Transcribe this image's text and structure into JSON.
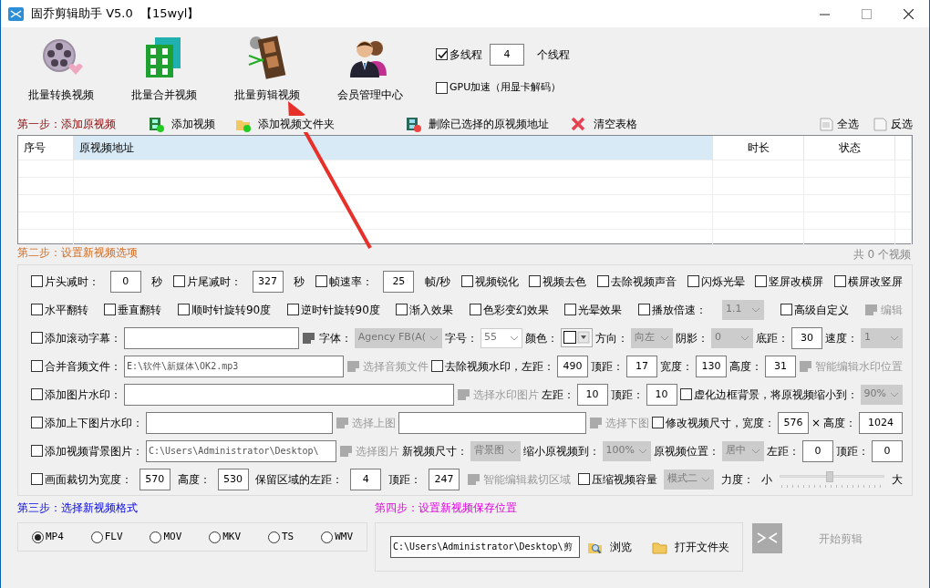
{
  "window": {
    "title": "固乔剪辑助手 V5.0  【15wyl】"
  },
  "toolbar": [
    {
      "kind": "convert",
      "label": "批量转换视频"
    },
    {
      "kind": "merge",
      "label": "批量合并视频"
    },
    {
      "kind": "edit",
      "label": "批量剪辑视频"
    },
    {
      "kind": "members",
      "label": "会员管理中心"
    }
  ],
  "threads": {
    "multithread": {
      "label": "多线程",
      "checked": true
    },
    "count": "4",
    "unit": "个线程",
    "gpu": {
      "label": "GPU加速（用显卡解码）",
      "checked": false
    }
  },
  "step1": {
    "title": "第一步：添加原视频",
    "actions": [
      {
        "kind": "add",
        "label": "添加视频"
      },
      {
        "kind": "folder",
        "label": "添加视频文件夹"
      },
      {
        "kind": "delete",
        "label": "删除已选择的原视频地址"
      },
      {
        "kind": "clear",
        "label": "清空表格"
      }
    ],
    "select_all": "全选",
    "invert": "反选"
  },
  "table": {
    "columns": [
      {
        "label": "序号",
        "selected": false
      },
      {
        "label": "原视频地址",
        "selected": true
      },
      {
        "label": "时长",
        "selected": false
      },
      {
        "label": "状态",
        "selected": false
      }
    ],
    "count": "共 0 个视频"
  },
  "step2": {
    "title": "第二步：设置新视频选项",
    "rows": [
      {
        "items": [
          {
            "kind": "check",
            "label": "片头减时：",
            "checked": false
          },
          {
            "kind": "number",
            "value": "0"
          },
          {
            "kind": "text",
            "label": "秒"
          },
          {
            "kind": "check",
            "label": "片尾减时：",
            "checked": false
          },
          {
            "kind": "number",
            "value": "327"
          },
          {
            "kind": "text",
            "label": "秒"
          },
          {
            "kind": "check",
            "label": "帧速率：",
            "checked": false
          },
          {
            "kind": "number",
            "value": "25"
          },
          {
            "kind": "text",
            "label": "帧/秒"
          },
          {
            "kind": "check",
            "label": "视频锐化",
            "checked": false
          },
          {
            "kind": "check",
            "label": "视频去色",
            "checked": false
          },
          {
            "kind": "check",
            "label": "去除视频声音",
            "checked": false
          },
          {
            "kind": "check",
            "label": "闪烁光晕",
            "checked": false
          },
          {
            "kind": "check",
            "label": "竖屏改横屏",
            "checked": false
          },
          {
            "kind": "check",
            "label": "横屏改竖屏",
            "checked": false
          }
        ]
      },
      {
        "items": [
          {
            "kind": "check",
            "label": "水平翻转",
            "checked": false
          },
          {
            "kind": "check",
            "label": "垂直翻转",
            "checked": false
          },
          {
            "kind": "check",
            "label": "顺时针旋转90度",
            "checked": false
          },
          {
            "kind": "check",
            "label": "逆时针旋转90度",
            "checked": false
          },
          {
            "kind": "check",
            "label": "渐入效果",
            "checked": false
          },
          {
            "kind": "check",
            "label": "色彩变幻效果",
            "checked": false
          },
          {
            "kind": "check",
            "label": "光晕效果",
            "checked": false
          },
          {
            "kind": "check",
            "label": "播放倍速：",
            "checked": false
          },
          {
            "kind": "select",
            "value": "1.1",
            "disabled": true
          },
          {
            "kind": "check",
            "label": "高级自定义",
            "checked": false
          },
          {
            "kind": "tool",
            "label": "编辑",
            "disabled": true
          }
        ]
      },
      {
        "items": [
          {
            "kind": "check",
            "label": "添加滚动字幕：",
            "checked": false
          },
          {
            "kind": "path"
          },
          {
            "kind": "tool",
            "disabled": false
          },
          {
            "kind": "text",
            "label": "字体："
          },
          {
            "kind": "select",
            "value": "Agency FB(A(",
            "disabled": true
          },
          {
            "kind": "text",
            "label": "字号："
          },
          {
            "kind": "select",
            "value": "55",
            "disabled": false
          },
          {
            "kind": "text",
            "label": "颜色："
          },
          {
            "kind": "color"
          },
          {
            "kind": "text",
            "label": "方向："
          },
          {
            "kind": "select",
            "value": "向左",
            "disabled": true
          },
          {
            "kind": "text",
            "label": "阴影："
          },
          {
            "kind": "select",
            "value": "0",
            "disabled": true
          },
          {
            "kind": "text",
            "label": "底距："
          },
          {
            "kind": "number",
            "value": "30"
          },
          {
            "kind": "text",
            "label": "速度："
          },
          {
            "kind": "select",
            "value": "1",
            "disabled": true
          }
        ]
      },
      {
        "items": [
          {
            "kind": "check",
            "label": "合并音频文件：",
            "checked": false
          },
          {
            "kind": "path",
            "value": "E:\\软件\\新媒体\\OK2.mp3",
            "disabled": true
          },
          {
            "kind": "tool",
            "label": "选择音频文件",
            "disabled": true
          },
          {
            "kind": "check",
            "label": "去除视频水印，左距：",
            "checked": false
          },
          {
            "kind": "number",
            "value": "490"
          },
          {
            "kind": "text",
            "label": "顶距："
          },
          {
            "kind": "number",
            "value": "17"
          },
          {
            "kind": "text",
            "label": "宽度："
          },
          {
            "kind": "number",
            "value": "130"
          },
          {
            "kind": "text",
            "label": "高度："
          },
          {
            "kind": "number",
            "value": "31"
          },
          {
            "kind": "tool",
            "label": "智能编辑水印位置",
            "disabled": true
          }
        ]
      },
      {
        "items": [
          {
            "kind": "check",
            "label": "添加图片水印：",
            "checked": false
          },
          {
            "kind": "path"
          },
          {
            "kind": "tool",
            "label": "选择水印图片",
            "disabled": true
          },
          {
            "kind": "text",
            "label": "左距："
          },
          {
            "kind": "number",
            "value": "10"
          },
          {
            "kind": "text",
            "label": "顶距："
          },
          {
            "kind": "number",
            "value": "10"
          },
          {
            "kind": "check",
            "label": "虚化边框背景，将原视频缩小到：",
            "checked": false
          },
          {
            "kind": "select",
            "value": "90%",
            "disabled": true
          }
        ]
      },
      {
        "items": [
          {
            "kind": "check",
            "label": "添加上下图片水印：",
            "checked": false
          },
          {
            "kind": "path"
          },
          {
            "kind": "tool",
            "label": "选择上图",
            "disabled": true
          },
          {
            "kind": "path"
          },
          {
            "kind": "tool",
            "label": "选择下图",
            "disabled": true
          },
          {
            "kind": "check",
            "label": "修改视频尺寸，宽度：",
            "checked": false
          },
          {
            "kind": "number",
            "value": "576"
          },
          {
            "kind": "text",
            "label": "×"
          },
          {
            "kind": "text",
            "label": "高度："
          },
          {
            "kind": "number",
            "value": "1024"
          }
        ]
      },
      {
        "items": [
          {
            "kind": "check",
            "label": "添加视频背景图片：",
            "checked": false
          },
          {
            "kind": "path",
            "value": "C:\\Users\\Administrator\\Desktop\\",
            "disabled": true
          },
          {
            "kind": "tool",
            "label": "选择图片",
            "disabled": true
          },
          {
            "kind": "text",
            "label": "新视频尺寸："
          },
          {
            "kind": "select",
            "value": "背景图",
            "disabled": true
          },
          {
            "kind": "text",
            "label": "缩小原视频到："
          },
          {
            "kind": "select",
            "value": "100%",
            "disabled": true
          },
          {
            "kind": "text",
            "label": "原视频位置："
          },
          {
            "kind": "select",
            "value": "居中",
            "disabled": true
          },
          {
            "kind": "text",
            "label": "左距："
          },
          {
            "kind": "number",
            "value": "0"
          },
          {
            "kind": "text",
            "label": "顶距："
          },
          {
            "kind": "number",
            "value": "0"
          }
        ]
      },
      {
        "items": [
          {
            "kind": "check",
            "label": "画面裁切为宽度：",
            "checked": false
          },
          {
            "kind": "number",
            "value": "570"
          },
          {
            "kind": "text",
            "label": "高度："
          },
          {
            "kind": "number",
            "value": "530"
          },
          {
            "kind": "text",
            "label": "保留区域的左距："
          },
          {
            "kind": "number",
            "value": "4"
          },
          {
            "kind": "text",
            "label": "顶距："
          },
          {
            "kind": "number",
            "value": "247"
          },
          {
            "kind": "tool",
            "label": "智能编辑裁切区域",
            "disabled": true
          },
          {
            "kind": "check",
            "label": "压缩视频容量",
            "checked": false
          },
          {
            "kind": "select",
            "value": "模式二",
            "disabled": true
          },
          {
            "kind": "text",
            "label": "力度："
          },
          {
            "kind": "text",
            "label": "小"
          },
          {
            "kind": "slider",
            "level": 0.48
          },
          {
            "kind": "text",
            "label": "大"
          }
        ]
      }
    ]
  },
  "step3": {
    "title": "第三步：选择新视频格式",
    "formats": [
      {
        "label": "MP4",
        "selected": true
      },
      {
        "label": "FLV",
        "selected": false
      },
      {
        "label": "MOV",
        "selected": false
      },
      {
        "label": "MKV",
        "selected": false
      },
      {
        "label": "TS",
        "selected": false
      },
      {
        "label": "WMV",
        "selected": false
      }
    ]
  },
  "step4": {
    "title": "第四步：设置新视频保存位置",
    "path": "C:\\Users\\Administrator\\Desktop\\剪",
    "browse": "浏览",
    "open_folder": "打开文件夹",
    "start": {
      "label": "开始剪辑",
      "disabled": true
    }
  }
}
